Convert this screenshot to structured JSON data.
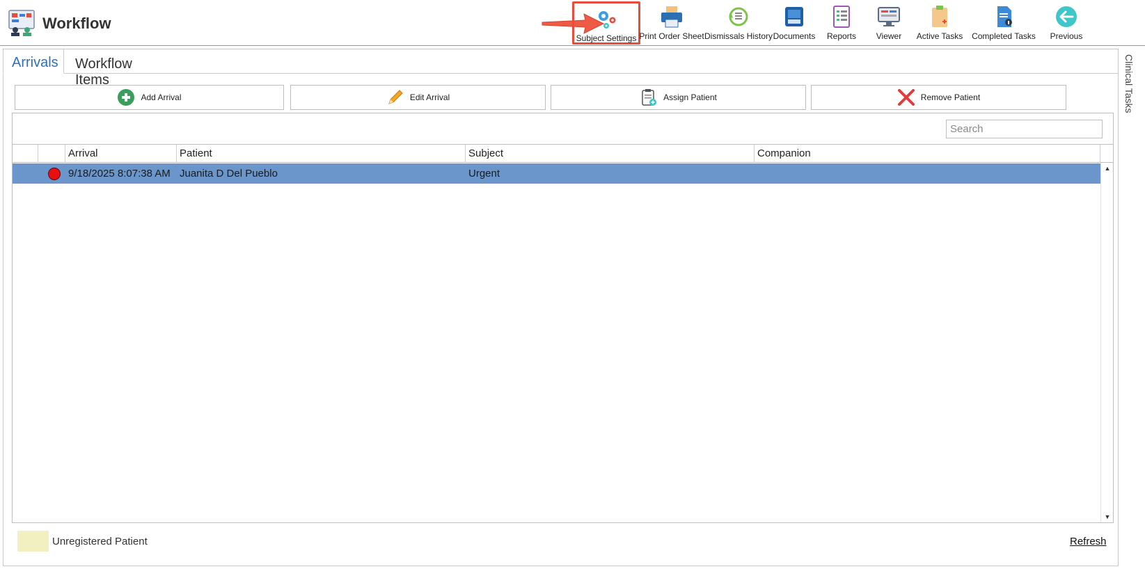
{
  "app": {
    "title": "Workflow"
  },
  "toolbar": {
    "buttons": [
      {
        "label": "Subject Settings",
        "icon": "gears-icon"
      },
      {
        "label": "Print Order Sheet",
        "icon": "printer-icon"
      },
      {
        "label": "Dismissals History",
        "icon": "history-icon"
      },
      {
        "label": "Documents",
        "icon": "inbox-icon"
      },
      {
        "label": "Reports",
        "icon": "report-icon"
      },
      {
        "label": "Viewer",
        "icon": "viewer-icon"
      },
      {
        "label": "Active Tasks",
        "icon": "active-tasks-icon"
      },
      {
        "label": "Completed Tasks",
        "icon": "completed-tasks-icon"
      },
      {
        "label": "Previous",
        "icon": "back-arrow-icon"
      }
    ]
  },
  "tabs": [
    {
      "label": "Arrivals",
      "active": true
    },
    {
      "label": "Workflow Items",
      "active": false
    }
  ],
  "side_panel": {
    "label": "Clinical Tasks"
  },
  "actions": {
    "add": "Add Arrival",
    "edit": "Edit Arrival",
    "assign": "Assign Patient",
    "remove": "Remove Patient"
  },
  "search": {
    "placeholder": "Search",
    "value": ""
  },
  "grid": {
    "columns": [
      "",
      "",
      "Arrival",
      "Patient",
      "Subject",
      "Companion"
    ],
    "rows": [
      {
        "status": "red-dot",
        "arrival": "9/18/2025 8:07:38 AM",
        "patient": "Juanita D Del Pueblo",
        "subject": "Urgent",
        "companion": ""
      }
    ]
  },
  "legend": {
    "label": "Unregistered Patient",
    "color": "#f2efc0"
  },
  "footer": {
    "refresh": "Refresh"
  },
  "colors": {
    "accent": "#2f6fbf",
    "selected_row": "#6b96cc",
    "highlight_box": "#e74c3c",
    "status_red": "#ea0f0f"
  }
}
